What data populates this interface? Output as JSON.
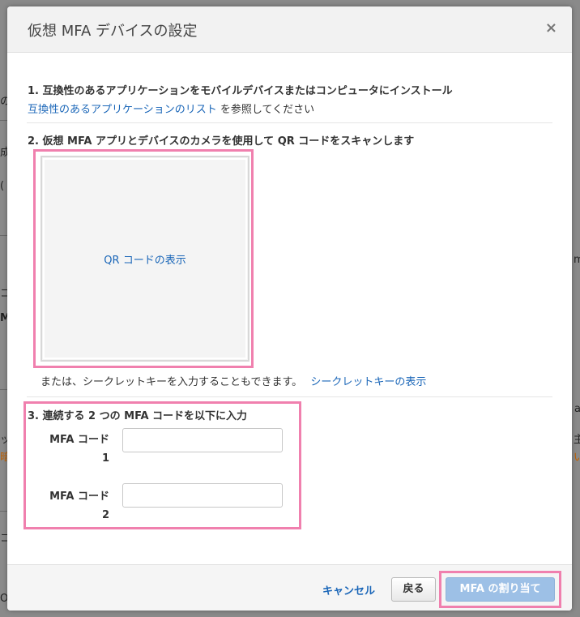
{
  "background": {
    "frags": [
      "の",
      "成",
      "(",
      "m",
      "コ",
      "Mi",
      "a",
      "ッ",
      "暗",
      "主",
      "い",
      "コ",
      "O"
    ]
  },
  "dialog": {
    "title": "仮想 MFA デバイスの設定",
    "close_symbol": "×"
  },
  "step1": {
    "title": "1. 互換性のあるアプリケーションをモバイルデバイスまたはコンピュータにインストール",
    "link": "互換性のあるアプリケーションのリスト",
    "suffix": " を参照してください"
  },
  "step2": {
    "title": "2. 仮想 MFA アプリとデバイスのカメラを使用して QR コードをスキャンします",
    "qr_link": "QR コードの表示",
    "alt_text": "または、シークレットキーを入力することもできます。",
    "secret_link": "シークレットキーの表示"
  },
  "step3": {
    "title": "3. 連続する 2 つの MFA コードを以下に入力",
    "code1_label": "MFA コード 1",
    "code1_value": "",
    "code2_label": "MFA コード 2",
    "code2_value": ""
  },
  "footer": {
    "cancel": "キャンセル",
    "back": "戻る",
    "assign": "MFA の割り当て"
  },
  "colors": {
    "highlight": "#f080ae",
    "link": "#1a66b8",
    "primary_disabled": "#9dc0e6"
  }
}
